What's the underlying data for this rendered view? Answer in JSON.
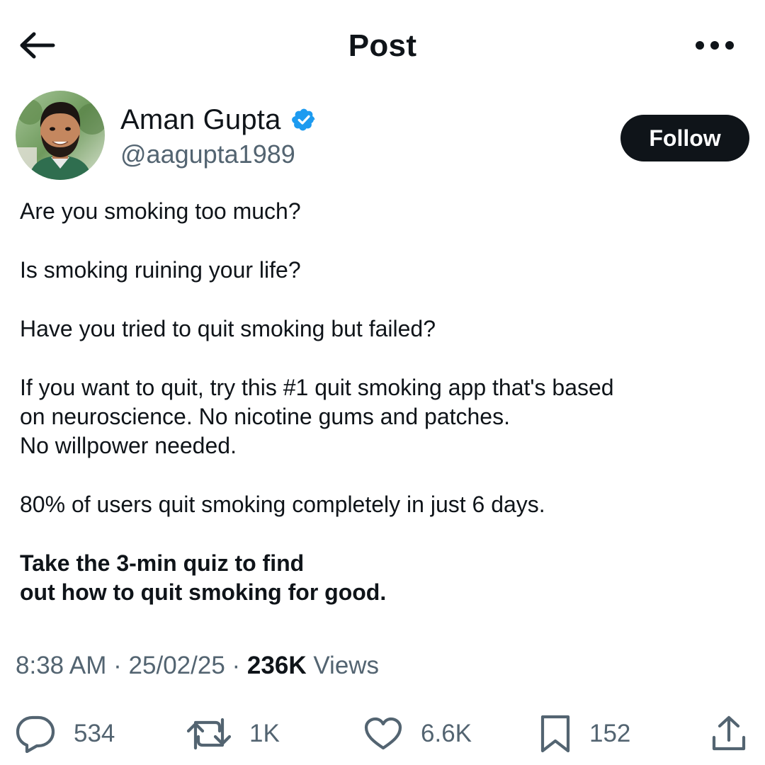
{
  "header": {
    "title": "Post",
    "back_icon": "arrow-left-icon",
    "more_icon": "ellipsis-icon"
  },
  "author": {
    "name": "Aman Gupta",
    "handle": "@aagupta1989",
    "verified": true,
    "verified_color": "#1d9bf0",
    "follow_label": "Follow"
  },
  "post": {
    "lines": [
      "Are you smoking too much?",
      "Is smoking ruining your life?",
      "Have you tried to quit smoking but failed?",
      "If you want to quit, try this #1 quit smoking app that's based",
      "on neuroscience. No nicotine gums and patches.",
      "No willpower needed.",
      "80% of users quit smoking completely in just 6 days.",
      "Take the 3-min quiz to find",
      "out how to quit smoking for good."
    ]
  },
  "meta": {
    "time": "8:38 AM",
    "date": "25/02/25",
    "separator": "·",
    "views_count": "236K",
    "views_label": "Views"
  },
  "actions": {
    "replies": "534",
    "reposts": "1K",
    "likes": "6.6K",
    "bookmarks": "152"
  },
  "colors": {
    "text": "#0f1419",
    "secondary": "#536471",
    "follow_bg": "#0f1419",
    "follow_text": "#ffffff"
  }
}
